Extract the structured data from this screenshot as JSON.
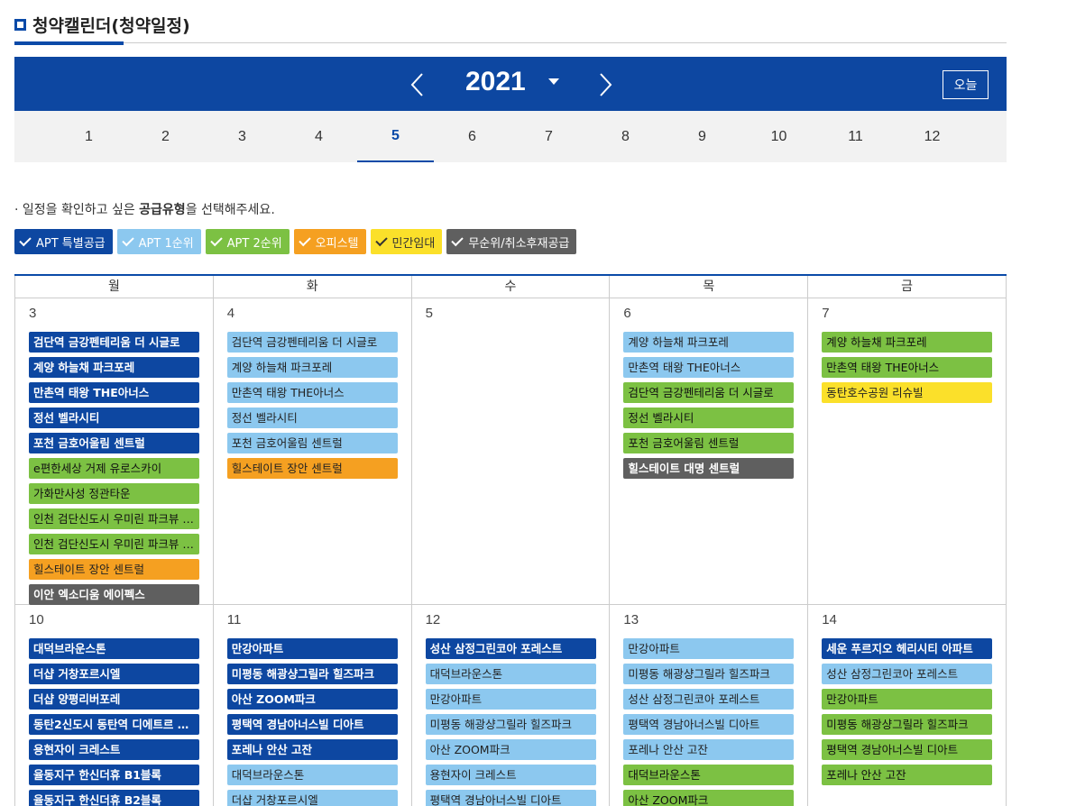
{
  "page": {
    "title": "청약캘린더(청약일정)"
  },
  "year_bar": {
    "year": "2021",
    "today_label": "오늘"
  },
  "months": [
    "1",
    "2",
    "3",
    "4",
    "5",
    "6",
    "7",
    "8",
    "9",
    "10",
    "11",
    "12"
  ],
  "active_month": "5",
  "help": {
    "prefix": "· 일정을 확인하고 싶은 ",
    "bold": "공급유형",
    "suffix": "을 선택해주세요."
  },
  "filters": [
    {
      "label": "APT 특별공급",
      "bg": "#0d47a1",
      "fg": "#ffffff"
    },
    {
      "label": "APT 1순위",
      "bg": "#8cc8ef",
      "fg": "#ffffff"
    },
    {
      "label": "APT 2순위",
      "bg": "#7cc143",
      "fg": "#ffffff"
    },
    {
      "label": "오피스텔",
      "bg": "#f5a021",
      "fg": "#ffffff"
    },
    {
      "label": "민간임대",
      "bg": "#fbe02a",
      "fg": "#333333"
    },
    {
      "label": "무순위/취소후재공급",
      "bg": "#5f5f5f",
      "fg": "#ffffff"
    }
  ],
  "weekdays": [
    "월",
    "화",
    "수",
    "목",
    "금"
  ],
  "weeks": [
    [
      {
        "day": "3",
        "events": [
          {
            "t": "검단역 금강펜테리움 더 시글로",
            "c": "special"
          },
          {
            "t": "계양 하늘채 파크포레",
            "c": "special"
          },
          {
            "t": "만촌역 태왕 THE아너스",
            "c": "special"
          },
          {
            "t": "정선 벨라시티",
            "c": "special"
          },
          {
            "t": "포천 금호어울림 센트럴",
            "c": "special"
          },
          {
            "t": "e편한세상 거제 유로스카이",
            "c": "second"
          },
          {
            "t": "가화만사성 정관타운",
            "c": "second"
          },
          {
            "t": "인천 검단신도시 우미린 파크뷰 …",
            "c": "second"
          },
          {
            "t": "인천 검단신도시 우미린 파크뷰 …",
            "c": "second"
          },
          {
            "t": "힐스테이트 장안 센트럴",
            "c": "officetel"
          },
          {
            "t": "이안 엑소디움 에이펙스",
            "c": "remain"
          }
        ]
      },
      {
        "day": "4",
        "events": [
          {
            "t": "검단역 금강펜테리움 더 시글로",
            "c": "first"
          },
          {
            "t": "계양 하늘채 파크포레",
            "c": "first"
          },
          {
            "t": "만촌역 태왕 THE아너스",
            "c": "first"
          },
          {
            "t": "정선 벨라시티",
            "c": "first"
          },
          {
            "t": "포천 금호어울림 센트럴",
            "c": "first"
          },
          {
            "t": "힐스테이트 장안 센트럴",
            "c": "officetel"
          }
        ]
      },
      {
        "day": "5",
        "events": []
      },
      {
        "day": "6",
        "events": [
          {
            "t": "계양 하늘채 파크포레",
            "c": "first"
          },
          {
            "t": "만촌역 태왕 THE아너스",
            "c": "first"
          },
          {
            "t": "검단역 금강펜테리움 더 시글로",
            "c": "second"
          },
          {
            "t": "정선 벨라시티",
            "c": "second"
          },
          {
            "t": "포천 금호어울림 센트럴",
            "c": "second"
          },
          {
            "t": "힐스테이트 대명 센트럴",
            "c": "remain"
          }
        ]
      },
      {
        "day": "7",
        "events": [
          {
            "t": "계양 하늘채 파크포레",
            "c": "second"
          },
          {
            "t": "만촌역 태왕 THE아너스",
            "c": "second"
          },
          {
            "t": "동탄호수공원 리슈빌",
            "c": "rental"
          }
        ]
      }
    ],
    [
      {
        "day": "10",
        "events": [
          {
            "t": "대덕브라운스톤",
            "c": "special"
          },
          {
            "t": "더샵 거창포르시엘",
            "c": "special"
          },
          {
            "t": "더샵 양평리버포레",
            "c": "special"
          },
          {
            "t": "동탄2신도시 동탄역 디에트르 …",
            "c": "special"
          },
          {
            "t": "용현자이 크레스트",
            "c": "special"
          },
          {
            "t": "율동지구 한신더휴 B1블록",
            "c": "special"
          },
          {
            "t": "율동지구 한신더휴 B2블록",
            "c": "special"
          }
        ]
      },
      {
        "day": "11",
        "events": [
          {
            "t": "만강아파트",
            "c": "special"
          },
          {
            "t": "미평동 해광샹그릴라 힐즈파크",
            "c": "special"
          },
          {
            "t": "아산 ZOOM파크",
            "c": "special"
          },
          {
            "t": "평택역 경남아너스빌 디아트",
            "c": "special"
          },
          {
            "t": "포레나 안산 고잔",
            "c": "special"
          },
          {
            "t": "대덕브라운스톤",
            "c": "first"
          },
          {
            "t": "더샵 거창포르시엘",
            "c": "first"
          }
        ]
      },
      {
        "day": "12",
        "events": [
          {
            "t": "성산 삼정그린코아 포레스트",
            "c": "special"
          },
          {
            "t": "대덕브라운스톤",
            "c": "first"
          },
          {
            "t": "만강아파트",
            "c": "first"
          },
          {
            "t": "미평동 해광샹그릴라 힐즈파크",
            "c": "first"
          },
          {
            "t": "아산 ZOOM파크",
            "c": "first"
          },
          {
            "t": "용현자이 크레스트",
            "c": "first"
          },
          {
            "t": "평택역 경남아너스빌 디아트",
            "c": "first"
          }
        ]
      },
      {
        "day": "13",
        "events": [
          {
            "t": "만강아파트",
            "c": "first"
          },
          {
            "t": "미평동 해광샹그릴라 힐즈파크",
            "c": "first"
          },
          {
            "t": "성산 삼정그린코아 포레스트",
            "c": "first"
          },
          {
            "t": "평택역 경남아너스빌 디아트",
            "c": "first"
          },
          {
            "t": "포레나 안산 고잔",
            "c": "first"
          },
          {
            "t": "대덕브라운스톤",
            "c": "second"
          },
          {
            "t": "아산 ZOOM파크",
            "c": "second"
          }
        ]
      },
      {
        "day": "14",
        "events": [
          {
            "t": "세운 푸르지오 헤리시티 아파트",
            "c": "special"
          },
          {
            "t": "성산 삼정그린코아 포레스트",
            "c": "first"
          },
          {
            "t": "만강아파트",
            "c": "second"
          },
          {
            "t": "미평동 해광샹그릴라 힐즈파크",
            "c": "second"
          },
          {
            "t": "평택역 경남아너스빌 디아트",
            "c": "second"
          },
          {
            "t": "포레나 안산 고잔",
            "c": "second"
          }
        ]
      }
    ]
  ]
}
